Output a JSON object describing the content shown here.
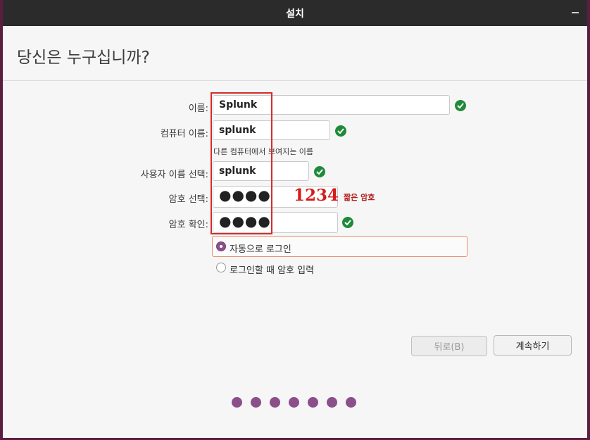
{
  "window": {
    "title": "설치"
  },
  "page": {
    "title": "당신은 누구십니까?"
  },
  "form": {
    "name_label": "이름:",
    "name_value": "Splunk",
    "computer_label": "컴퓨터 이름:",
    "computer_value": "splunk",
    "computer_hint": "다른 컴퓨터에서 보여지는 이름",
    "username_label": "사용자 이름 선택:",
    "username_value": "splunk",
    "password_label": "암호 선택:",
    "password_value": "●●●●",
    "password_overlay": "1234",
    "password_strength": "짧은 암호",
    "confirm_label": "암호 확인:",
    "confirm_value": "●●●●"
  },
  "login_options": {
    "auto": "자동으로 로그인",
    "require_password": "로그인할 때 암호 입력",
    "selected": "auto"
  },
  "buttons": {
    "back": "뒤로(B)",
    "continue": "계속하기"
  },
  "progress": {
    "total_steps": 7
  },
  "colors": {
    "accent": "#8b4f8a",
    "check": "#1f8a3a",
    "warning": "#b31d1d",
    "highlight": "#d62b2b"
  },
  "icons": {
    "valid": "check-circle-icon"
  }
}
